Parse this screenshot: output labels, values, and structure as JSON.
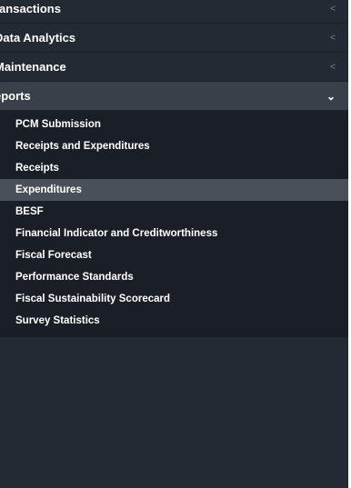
{
  "menu": {
    "items": [
      {
        "label": "ransactions",
        "chevron": "<"
      },
      {
        "label": "Data Analytics",
        "chevron": "<"
      },
      {
        "label": "Maintenance",
        "chevron": "<"
      },
      {
        "label": "eports",
        "chevron": "⌄"
      }
    ]
  },
  "reports_submenu": [
    {
      "label": "PCM Submission"
    },
    {
      "label": "Receipts and Expenditures"
    },
    {
      "label": "Receipts"
    },
    {
      "label": "Expenditures"
    },
    {
      "label": "BESF"
    },
    {
      "label": "Financial Indicator and Creditworthiness"
    },
    {
      "label": "Fiscal Forecast"
    },
    {
      "label": "Performance Standards"
    },
    {
      "label": "Fiscal Sustainability Scorecard"
    },
    {
      "label": "Survey Statistics"
    }
  ],
  "active_submenu_item": "Expenditures",
  "colors": {
    "sidebar_bg": "#232a33",
    "open_header_bg": "#3a4049",
    "submenu_bg": "#1a1f27",
    "active_item_bg": "#4a5059",
    "text": "#ffffff",
    "chevron_muted": "#7a8390"
  },
  "icons": {
    "collapsed": "chevron-left-icon",
    "expanded": "chevron-down-icon"
  }
}
